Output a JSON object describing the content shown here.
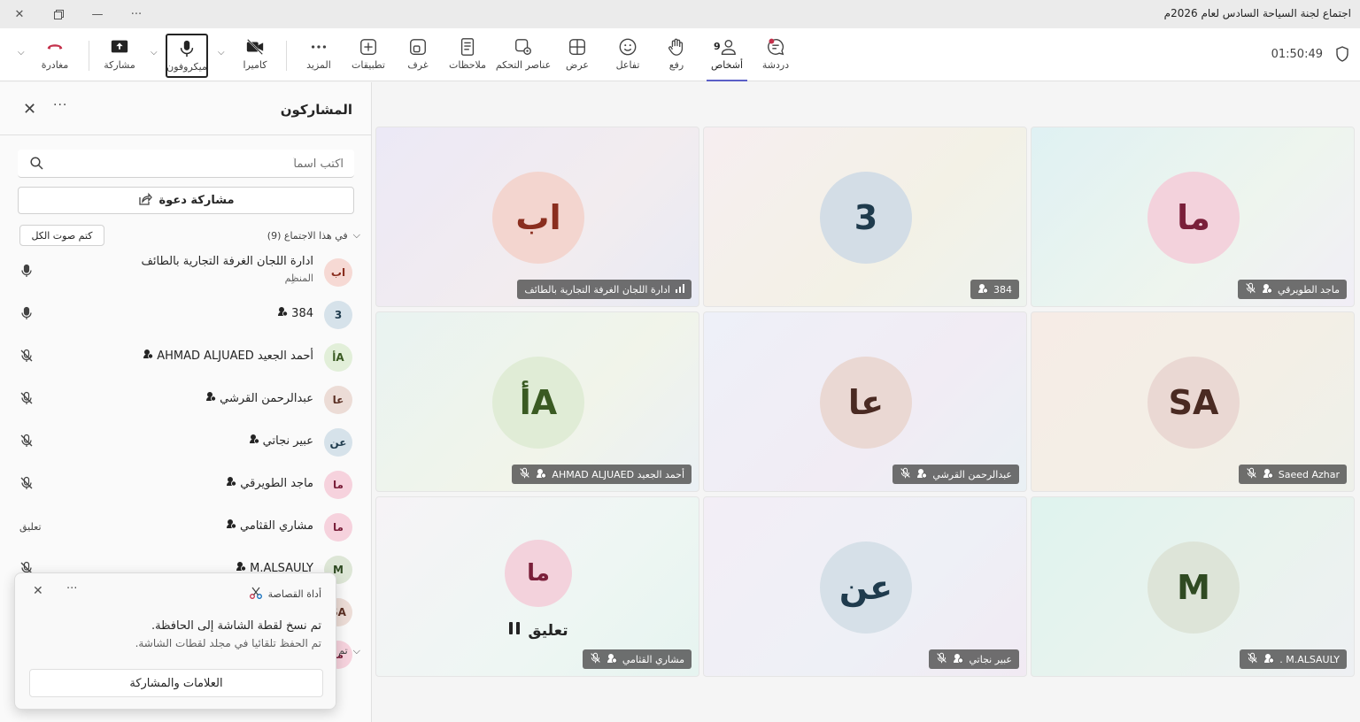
{
  "window": {
    "title": "اجتماع لجنة السياحة السادس لعام 2026م"
  },
  "toolbar": {
    "timer": "01:50:49",
    "people_count": "9",
    "items": {
      "chat": "دردشة",
      "people": "أشخاص",
      "raise": "رفع",
      "react": "تفاعل",
      "view": "عرض",
      "controls": "عناصر التحكم",
      "notes": "ملاحظات",
      "rooms": "غرف",
      "apps": "تطبيقات",
      "more": "المزيد",
      "camera": "كاميرا",
      "mic": "ميكروفون",
      "share": "مشاركة",
      "leave": "مغادرة"
    },
    "colors": {
      "leave": "#c4314b",
      "accent": "#5b5fc7"
    }
  },
  "panel": {
    "title": "المشاركون",
    "search_placeholder": "اكتب اسماً",
    "invite_label": "مشاركة دعوة",
    "section_label": "في هذا الاجتماع (9)",
    "mute_all_label": "كتم صوت الكل",
    "collapsed_section_label": "تم",
    "participants": [
      {
        "initials": "اب",
        "name": "ادارة اللجان الغرفة التجارية بالطائف",
        "role": "المنظِم",
        "mic": "on",
        "status": "",
        "bg": "#f6d9d4",
        "fg": "#8a2e1f"
      },
      {
        "initials": "3",
        "name": "384",
        "role": "",
        "mic": "on",
        "status": "",
        "bg": "#d6e2ea",
        "fg": "#1f3b4d"
      },
      {
        "initials": "أA",
        "name": "أحمد الجعيد AHMAD ALJUAED",
        "role": "",
        "mic": "off",
        "status": "",
        "bg": "#e2efd9",
        "fg": "#3a5a22"
      },
      {
        "initials": "عا",
        "name": "عبدالرحمن القرشي",
        "role": "",
        "mic": "off",
        "status": "",
        "bg": "#ecdcd6",
        "fg": "#5a2e22"
      },
      {
        "initials": "عن",
        "name": "عبير نجاتي",
        "role": "",
        "mic": "off",
        "status": "",
        "bg": "#d6e2ea",
        "fg": "#1f3b4d"
      },
      {
        "initials": "ما",
        "name": "ماجد الطويرقي",
        "role": "",
        "mic": "off",
        "status": "",
        "bg": "#f6d2dd",
        "fg": "#7a1f3a"
      },
      {
        "initials": "ما",
        "name": "مشاري القثامي",
        "role": "",
        "mic": "none",
        "status": "تعليق",
        "bg": "#f6d2dd",
        "fg": "#7a1f3a"
      },
      {
        "initials": "M",
        "name": "M.ALSAULY",
        "role": "",
        "mic": "off",
        "status": "",
        "bg": "#dde6d6",
        "fg": "#2f4a22"
      },
      {
        "initials": "SA",
        "name": "",
        "role": "",
        "mic": "none",
        "status": "",
        "bg": "#ecdcd6",
        "fg": "#5a2e22"
      },
      {
        "initials": "ما",
        "name": "",
        "role": "",
        "mic": "none",
        "status": "",
        "bg": "#f6d2dd",
        "fg": "#7a1f3a"
      }
    ]
  },
  "toast": {
    "app_name": "أداة القصاصة",
    "message": "تم نسخ لقطة الشاشة إلى الحافظة.",
    "sub": "تم الحفظ تلقائيا في مجلد لقطات الشاشة.",
    "button": "العلامات والمشاركة"
  },
  "tiles": [
    {
      "initials": "ما",
      "name": "ماجد الطويرقي",
      "bg": "#f3d2dc",
      "fg": "#7a1f3a",
      "muted": true,
      "speaker": false,
      "hold": false,
      "tile_bg": "linear-gradient(135deg,#dff1f3,#eef5ee 60%,#f1eef6)"
    },
    {
      "initials": "3",
      "name": "384",
      "bg": "#d3dde6",
      "fg": "#1f3b4d",
      "muted": false,
      "speaker": false,
      "hold": false,
      "tile_bg": "linear-gradient(135deg,#f6eef0,#f3f1e6 60%,#eef3ee)"
    },
    {
      "initials": "اب",
      "name": "ادارة اللجان الغرفة التجارية بالطائف",
      "bg": "#f3d5cf",
      "fg": "#8a2e1f",
      "muted": false,
      "speaker": true,
      "hold": false,
      "tile_bg": "linear-gradient(135deg,#ece9f6,#f2ecef 60%,#e8eaf4)"
    },
    {
      "initials": "SA",
      "name": "Saeed Azhar",
      "bg": "#ead8d3",
      "fg": "#4a2a22",
      "muted": true,
      "speaker": false,
      "hold": false,
      "tile_bg": "linear-gradient(135deg,#f6ece6,#f3efe6 60%,#eef0ea)"
    },
    {
      "initials": "عا",
      "name": "عبدالرحمن القرشي",
      "bg": "#ead8d3",
      "fg": "#4a2a22",
      "muted": true,
      "speaker": false,
      "hold": false,
      "tile_bg": "linear-gradient(135deg,#eef0f8,#f1ecf4 60%,#e9f0f4)"
    },
    {
      "initials": "أA",
      "name": "أحمد الجعيد AHMAD ALJUAED",
      "bg": "#e0ecd6",
      "fg": "#3a5a22",
      "muted": true,
      "speaker": false,
      "hold": false,
      "tile_bg": "linear-gradient(135deg,#e9f3f1,#f1f4ea 60%,#eaf0f4)"
    },
    {
      "initials": "M",
      "name": "M.ALSAULY .",
      "bg": "#dde4d8",
      "fg": "#2f4a22",
      "muted": true,
      "speaker": false,
      "hold": false,
      "tile_bg": "linear-gradient(135deg,#dff3ee,#eaf3ee 60%,#eef0f3)"
    },
    {
      "initials": "عن",
      "name": "عبير نجاتي",
      "bg": "#d6e0e8",
      "fg": "#1f3b4d",
      "muted": true,
      "speaker": false,
      "hold": false,
      "tile_bg": "linear-gradient(135deg,#f3eef6,#eef0f6 60%,#f1eaf3)"
    },
    {
      "initials": "ما",
      "name": "مشاري القثامي",
      "bg": "#f3d2dc",
      "fg": "#7a1f3a",
      "muted": true,
      "speaker": false,
      "hold": true,
      "hold_label": "تعليق",
      "tile_bg": "linear-gradient(135deg,#f6f3f6,#eef6f3 60%,#e6f4f0)"
    }
  ]
}
